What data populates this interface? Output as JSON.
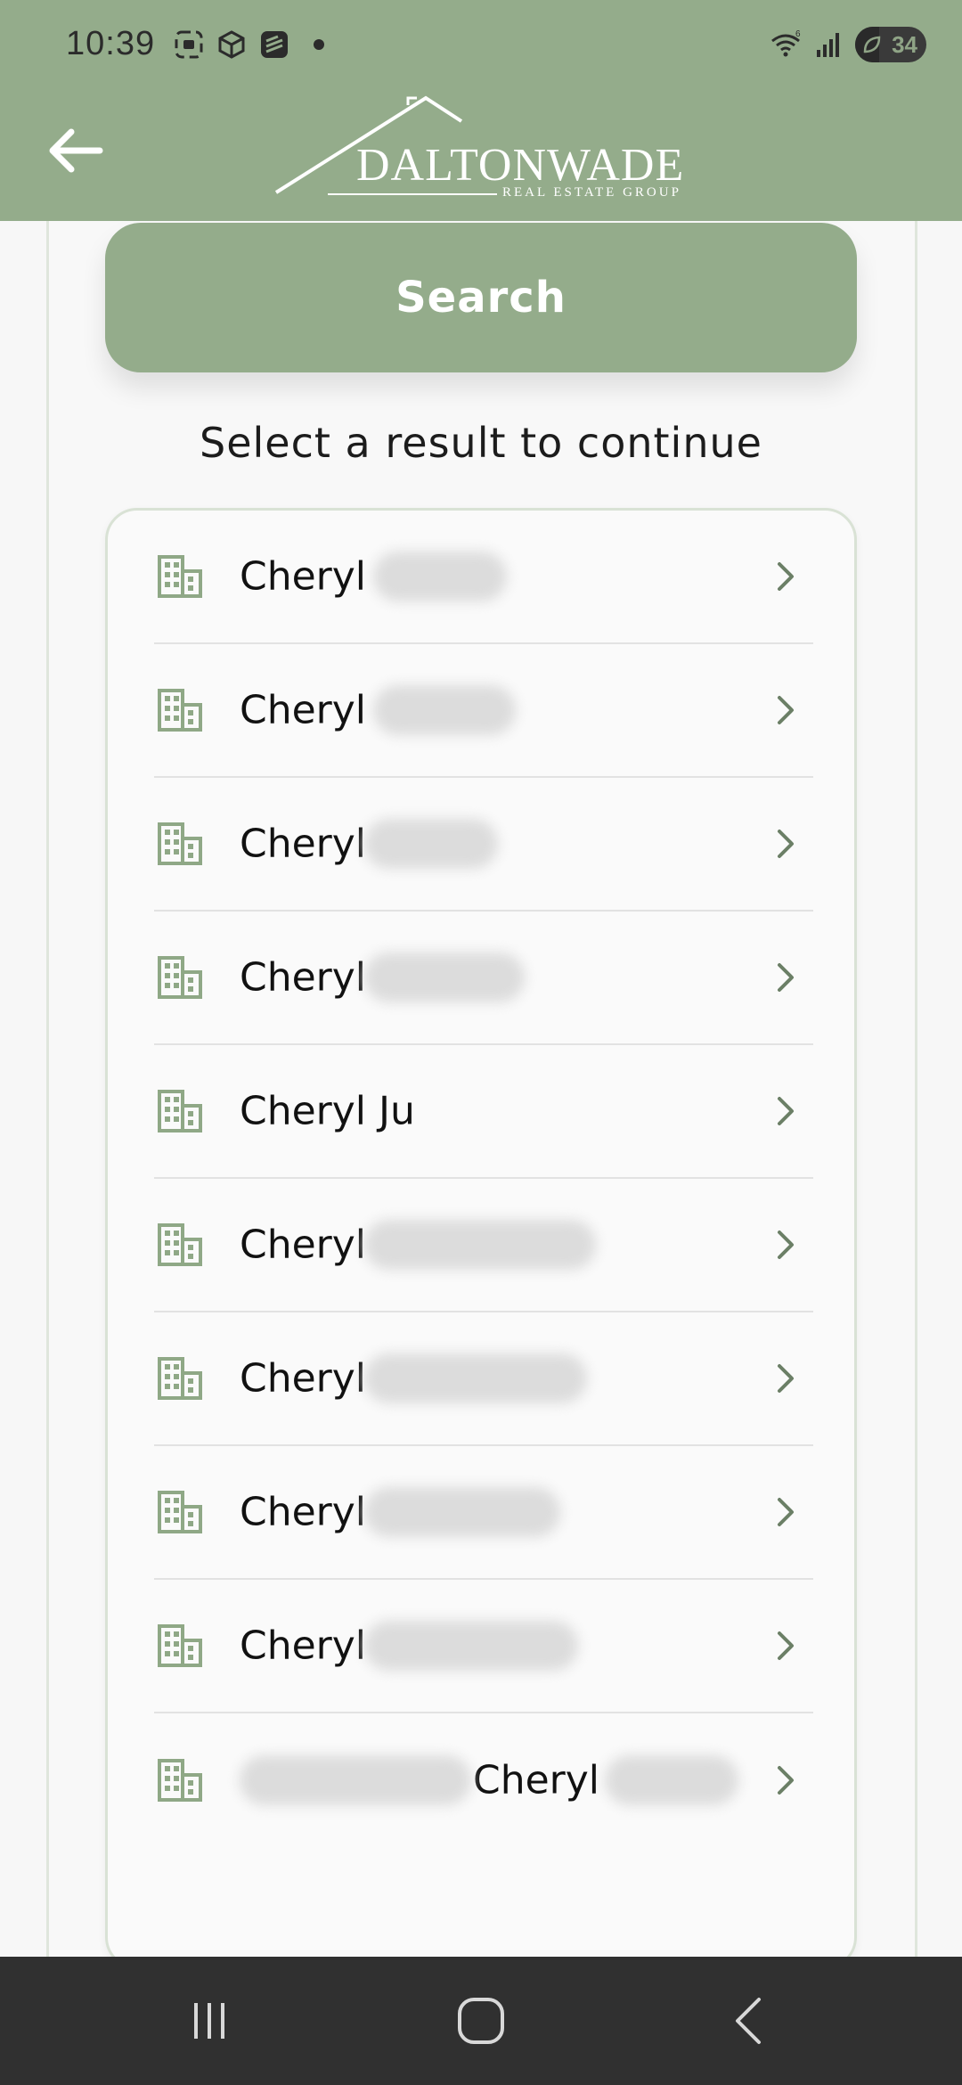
{
  "status_bar": {
    "time": "10:39",
    "battery_level": "34",
    "icons": [
      "screenshot-icon",
      "cube-icon",
      "stack-icon",
      "notification-dot-icon",
      "wifi-icon",
      "signal-icon",
      "battery-icon"
    ]
  },
  "header": {
    "back_icon": "arrow-left-icon",
    "logo_name": "DALTONWADE",
    "logo_subtitle": "REAL ESTATE GROUP",
    "background_color": "#94ac8b"
  },
  "search": {
    "button_label": "Search"
  },
  "main": {
    "subtitle": "Select a result to continue"
  },
  "results": [
    {
      "name": "Cheryl",
      "icon": "building-icon",
      "redacted": true
    },
    {
      "name": "Cheryl",
      "icon": "building-icon",
      "redacted": true
    },
    {
      "name": "Cheryl",
      "icon": "building-icon",
      "redacted": true
    },
    {
      "name": "Cheryl",
      "icon": "building-icon",
      "redacted": true
    },
    {
      "name": "Cheryl Ju",
      "icon": "building-icon",
      "redacted": false
    },
    {
      "name": "Cheryl",
      "icon": "building-icon",
      "redacted": true
    },
    {
      "name": "Cheryl",
      "icon": "building-icon",
      "redacted": true
    },
    {
      "name": "Cheryl",
      "icon": "building-icon",
      "redacted": true
    },
    {
      "name": "Cheryl",
      "icon": "building-icon",
      "redacted": true
    },
    {
      "name": "Cheryl",
      "icon": "building-icon",
      "redacted": true
    }
  ],
  "nav_bar": {
    "icons": [
      "recent-apps-icon",
      "home-icon",
      "back-icon"
    ]
  },
  "colors": {
    "accent": "#94ac8b",
    "icon_green": "#8fa886",
    "chevron": "#6b7f66",
    "navbar": "#303030"
  }
}
